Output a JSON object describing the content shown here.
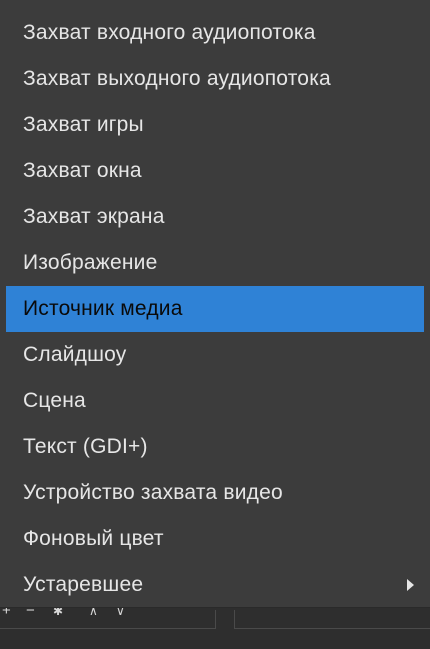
{
  "menu": {
    "items": [
      {
        "label": "Захват входного аудиопотока"
      },
      {
        "label": "Захват выходного аудиопотока"
      },
      {
        "label": "Захват игры"
      },
      {
        "label": "Захват окна"
      },
      {
        "label": "Захват экрана"
      },
      {
        "label": "Изображение"
      },
      {
        "label": "Источник медиа",
        "selected": true
      },
      {
        "label": "Слайдшоу"
      },
      {
        "label": "Сцена"
      },
      {
        "label": "Текст (GDI+)"
      },
      {
        "label": "Устройство захвата видео"
      },
      {
        "label": "Фоновый цвет"
      },
      {
        "label": "Устаревшее",
        "has_submenu": true
      }
    ]
  },
  "toolbar": {
    "add_icon": "+",
    "remove_icon": "−",
    "settings_icon": "✱",
    "up_icon": "∧",
    "down_icon": "∨"
  },
  "colors": {
    "menu_bg": "#3c3c3c",
    "selected_bg": "#2f82d6",
    "text": "#e6e6e6"
  }
}
